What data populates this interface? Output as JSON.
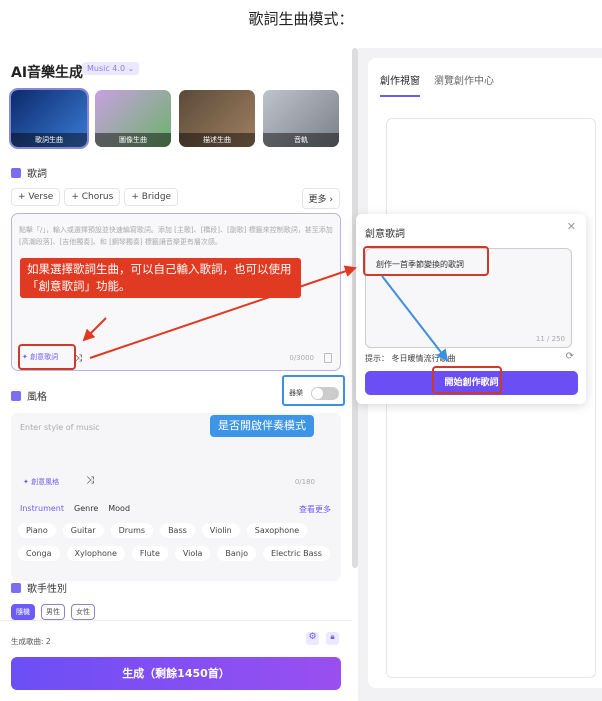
{
  "caption": "歌詞生曲模式：",
  "app": {
    "title": "AI音樂生成",
    "version": "Music 4.0 ⌄"
  },
  "modes": [
    "歌詞生曲",
    "圖像生曲",
    "描述生曲",
    "音軌"
  ],
  "lyrics": {
    "heading": "歌詞",
    "tags": [
      "+ Verse",
      "+ Chorus",
      "+ Bridge"
    ],
    "more": "更多 ›",
    "placeholder": "點擊「/」，輸入或選擇預設並快速編寫歌詞。添加 [主歌]、[橋段]、[副歌] 標籤來控制歌詞，甚至添加[高潮段落]、[吉他獨奏]、和 [鋼琴獨奏] 標籤讓音樂更有層次感。",
    "ai_button": "✦ 創意歌詞",
    "count": "0/3000"
  },
  "annotation_red": "如果選擇歌詞生曲，可以自己輸入歌詞，也可以使用「創意歌詞」功能。",
  "annotation_blue": "是否開啟伴奏模式",
  "style": {
    "heading": "風格",
    "instrumental_label": "器樂",
    "instrumental_on": false,
    "placeholder": "Enter style of music",
    "ai_button": "✦ 創意風格",
    "count": "0/180",
    "tabs": [
      "Instrument",
      "Genre",
      "Mood"
    ],
    "see_more": "查看更多",
    "row1": [
      "Piano",
      "Guitar",
      "Drums",
      "Bass",
      "Violin",
      "Saxophone"
    ],
    "row2": [
      "Conga",
      "Xylophone",
      "Flute",
      "Viola",
      "Banjo",
      "Electric Bass"
    ]
  },
  "singer": {
    "heading": "歌手性別",
    "options": [
      "隨機",
      "男性",
      "女性"
    ]
  },
  "footer": {
    "songs_label": "生成歌曲:",
    "songs_count": "2",
    "generate": "生成（剩餘1450首）"
  },
  "right": {
    "tabs": [
      "創作視窗",
      "瀏覽創作中心"
    ]
  },
  "popup": {
    "title": "創意歌詞",
    "value": "創作一首季節變換的歌詞",
    "count": "11 / 250",
    "hint": "提示： 冬日暖情流行歌曲",
    "button": "開始創作歌詞"
  }
}
